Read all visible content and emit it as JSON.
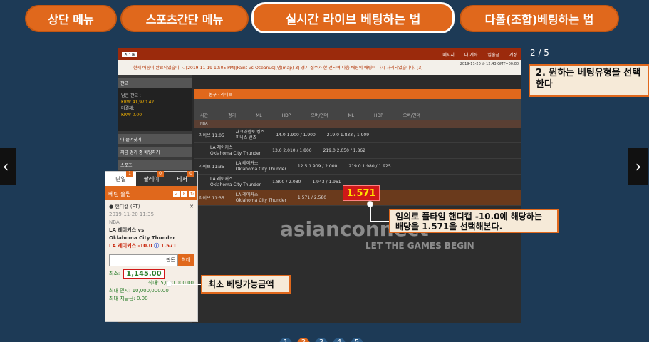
{
  "tabs": [
    {
      "label": "상단 메뉴",
      "active": false
    },
    {
      "label": "스포츠간단 메뉴",
      "active": false
    },
    {
      "label": "실시간 라이브 베팅하는 법",
      "active": true
    },
    {
      "label": "다폴(조합)베팅하는 법",
      "active": false
    }
  ],
  "navigation": {
    "prev": "‹",
    "next": "›",
    "counter": "2 / 5"
  },
  "callouts": {
    "step": "2. 원하는 베팅유형을 선택한다",
    "odds_note": "임의로 풀타임 핸디캡 -10.0에 해당하는 배당을 1.571을 선택해본다.",
    "min_note": "최소 베팅가능금액"
  },
  "screenshot": {
    "top_menus": [
      "메시지",
      "내 계좌",
      "입출금",
      "계정"
    ],
    "notice": "현재 배팅이 완료되었습니다. [2019-11-19 10:05 PM][Faint-vs-Oceanus][맵(map) 3]   경기 접수가 한 건되며 다음 배팅의 배팅이 다시 처리되었습니다. [3]",
    "date": "2019-11-20 ⊙ 12:43 GMT+00:00",
    "balance_label": "잔고",
    "balance_lines": [
      "남은 잔고 :",
      "KRW 41,970.42",
      "미결제:",
      "KRW 0.00"
    ],
    "side_buttons": [
      "내 즐겨찾기",
      "지금 경기 중 베팅하기",
      "스포츠"
    ],
    "sport_bar": "농구 · 라이브",
    "columns": [
      "시간",
      "경기",
      "ML",
      "HDP",
      "오버/언더",
      "ML",
      "HDP",
      "오버/언더"
    ],
    "region": "NBA",
    "rows": [
      {
        "time": "라이브 11:05",
        "home": "새크라멘토 킹스",
        "away": "피닉스 선즈",
        "hdp": "14.0  1.900 / 1.900",
        "ou": "219.0  1.833 / 1.909"
      },
      {
        "time": "",
        "home": "LA 레이커스",
        "away": "Oklahoma City Thunder",
        "hdp": "13.0  2.010 / 1.800",
        "ou": "219.0  2.050 / 1.862"
      },
      {
        "time": "라이브 11:35",
        "home": "LA 레이커스",
        "away": "Oklahoma City Thunder",
        "hdp": "12.5  1.909 / 2.000",
        "ou": "219.0  1.980 / 1.925"
      },
      {
        "time": "",
        "home": "LA 레이커스",
        "away": "Oklahoma City Thunder",
        "hdp": "  1.800 / 2.080",
        "ou": "  1.943 / 1.961"
      },
      {
        "time": "라이브 11:35",
        "home": "LA 레이커스",
        "away": "Oklahoma City Thunder",
        "hdp": "  1.571 / 2.580",
        "ou": ""
      }
    ],
    "selected_odds": "1.571",
    "watermark": "asianconnect",
    "watermark_sub": "LET THE GAMES BEGIN"
  },
  "bet_slip": {
    "tabs": [
      {
        "label": "단일",
        "badge": "1"
      },
      {
        "label": "팔레이",
        "badge": "0"
      },
      {
        "label": "티저",
        "badge": "0"
      }
    ],
    "header": "베팅 슬립",
    "market": "핸디캡 (FT)",
    "datetime": "2019-11-20 11:35",
    "league": "NBA",
    "home": "LA 레이커스 vs",
    "away": "Oklahoma City Thunder",
    "pick": "LA 레이커스 -10.0",
    "pick_odds": "1.571",
    "stake_placeholder": "판돈",
    "max_button": "최대",
    "min_label": "최소:",
    "min_value": "1,145.00",
    "max_label": "최대: 5,000,000.00",
    "max_win_label": "최대 믿지: 10,000,000.00",
    "max_payout_label": "최대 지급금: 0.00"
  },
  "pager": [
    "1",
    "2",
    "3",
    "4",
    "5"
  ]
}
